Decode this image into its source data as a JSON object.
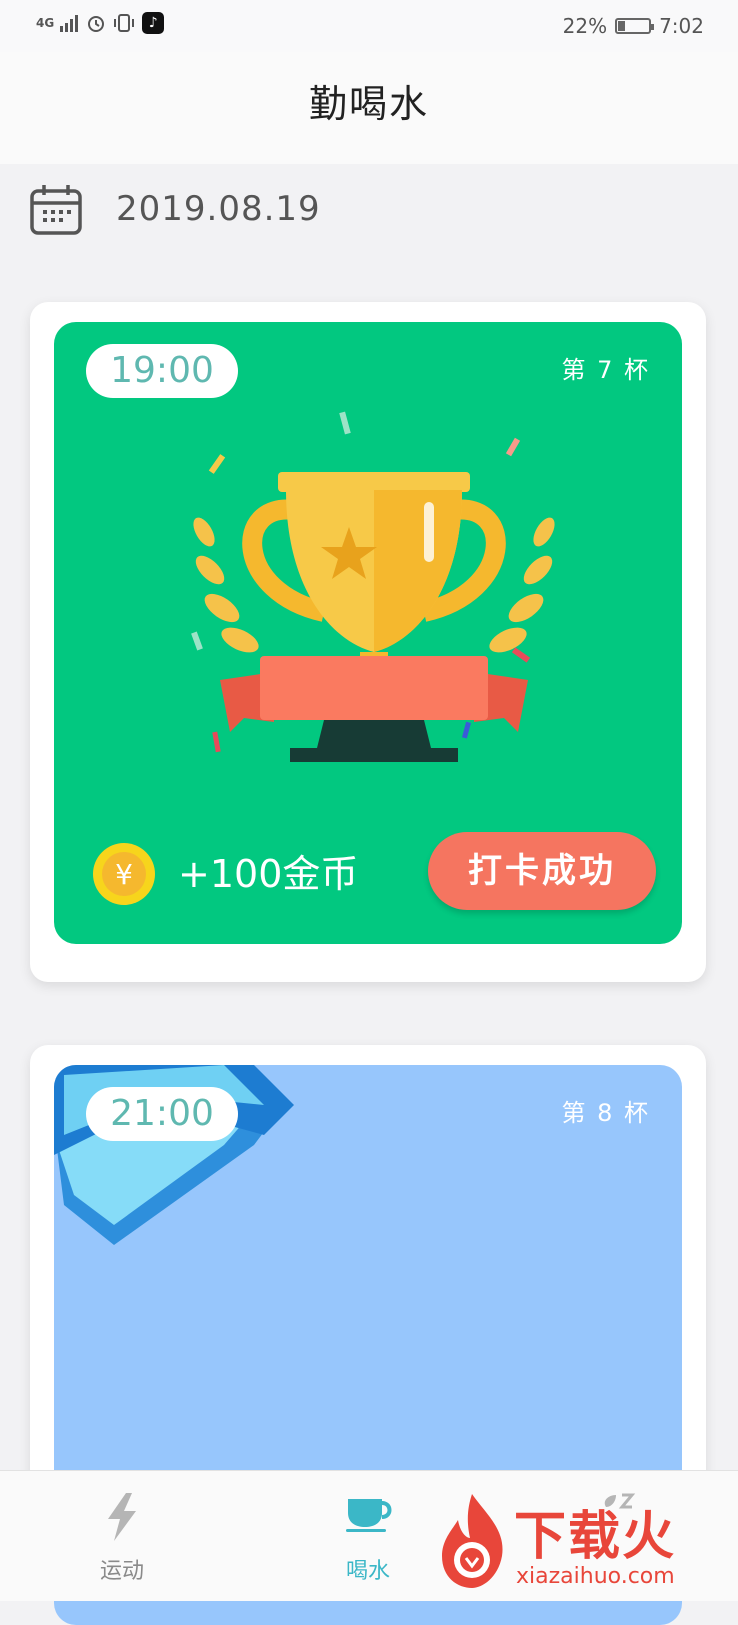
{
  "status_bar": {
    "network": "4G",
    "battery_percent": "22%",
    "battery_level": 0.22,
    "time": "7:02"
  },
  "header": {
    "title": "勤喝水"
  },
  "date": "2019.08.19",
  "cards": [
    {
      "time": "19:00",
      "cup_label": "第 7 杯",
      "reward": "+100金币",
      "coin_symbol": "¥",
      "action_label": "打卡成功",
      "bg_color": "#02c880"
    },
    {
      "time": "21:00",
      "cup_label": "第 8 杯",
      "bg_color": "#97c6fc"
    }
  ],
  "tabs": [
    {
      "label": "运动",
      "icon": "lightning-icon",
      "active": false
    },
    {
      "label": "喝水",
      "icon": "cup-icon",
      "active": true
    },
    {
      "label": "",
      "icon": "sleep-icon",
      "active": false
    }
  ],
  "watermark": {
    "text": "下载火",
    "url": "xiazaihuo.com"
  },
  "colors": {
    "accent": "#3bb7c7",
    "action": "#f57560",
    "success_bg": "#02c880",
    "pending_bg": "#97c6fc"
  }
}
